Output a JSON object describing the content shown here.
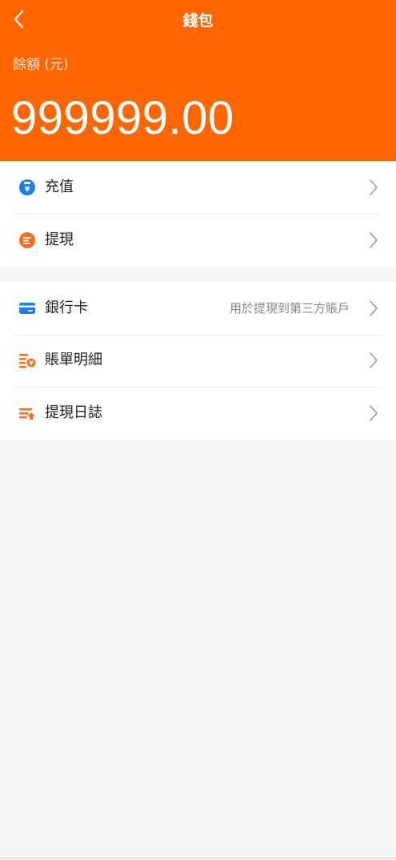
{
  "header": {
    "title": "錢包",
    "balance_label": "餘額 (元)",
    "balance_value": "999999.00",
    "bg_color": "#ff6600"
  },
  "menu_group_1": [
    {
      "label": "充值",
      "icon": "recharge-icon",
      "icon_color": "#1f7bf0"
    },
    {
      "label": "提現",
      "icon": "withdraw-icon",
      "icon_color": "#ff6a1a"
    }
  ],
  "menu_group_2": [
    {
      "label": "銀行卡",
      "hint": "用於提現到第三方賬戶",
      "icon": "bank-card-icon",
      "icon_color": "#1f7bf0"
    },
    {
      "label": "賬單明細",
      "icon": "bill-details-icon",
      "icon_color": "#ff6a1a"
    },
    {
      "label": "提現日誌",
      "icon": "withdraw-log-icon",
      "icon_color": "#ff6a1a"
    }
  ],
  "icons": {
    "back": "chevron-left-icon",
    "row_arrow": "chevron-right-icon"
  }
}
